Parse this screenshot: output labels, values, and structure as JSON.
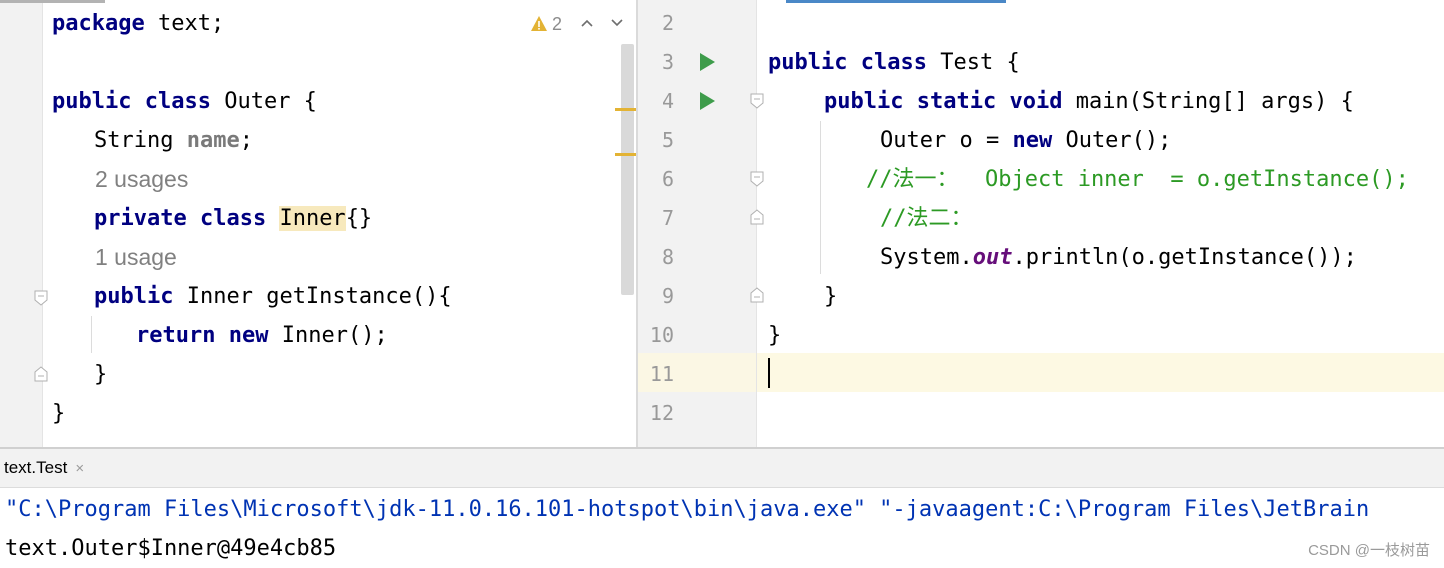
{
  "left_editor": {
    "inspections": {
      "warning_count": "2"
    },
    "lines": {
      "l1": {
        "kw": "package",
        "rest": " text;"
      },
      "l3": {
        "kw1": "public",
        "kw2": "class",
        "rest": " Outer {"
      },
      "l4": {
        "type": "String ",
        "field": "name",
        "end": ";"
      },
      "hint1": "2 usages",
      "l6": {
        "kw1": "private",
        "kw2": "class",
        "name": "Inner",
        "end": "{}"
      },
      "hint2": "1 usage",
      "l8": {
        "kw": "public",
        "rest": " Inner getInstance(){"
      },
      "l9": {
        "kw1": "return",
        "kw2": "new",
        "rest": " Inner();"
      },
      "l10": "}",
      "l11": "}"
    }
  },
  "right_editor": {
    "line_numbers": [
      "2",
      "3",
      "4",
      "5",
      "6",
      "7",
      "8",
      "9",
      "10",
      "11",
      "12"
    ],
    "lines": {
      "l3": {
        "kw1": "public",
        "kw2": "class",
        "rest": " Test {"
      },
      "l4": {
        "kw1": "public",
        "kw2": "static",
        "kw3": "void",
        "rest": " main(String[] args) {"
      },
      "l5": {
        "pre": "Outer o = ",
        "kw": "new",
        "rest": " Outer();"
      },
      "l6": "//法一：  Object inner  = o.getInstance();",
      "l7": "//法二：",
      "l8": {
        "pre": "System.",
        "field": "out",
        "rest": ".println(o.getInstance());"
      },
      "l9": "}",
      "l10": "}"
    }
  },
  "run_window": {
    "tab_label": "text.Test",
    "close_glyph": "×",
    "command_line": "\"C:\\Program Files\\Microsoft\\jdk-11.0.16.101-hotspot\\bin\\java.exe\" \"-javaagent:C:\\Program Files\\JetBrain",
    "output_line": "text.Outer$Inner@49e4cb85"
  },
  "watermark": "CSDN @一枝树苗",
  "colors": {
    "keyword": "#000080",
    "comment": "#2c9a24",
    "static_field": "#660e7a",
    "run_icon": "#3e9c4b",
    "warning": "#e3b334",
    "console_command": "#0033b3"
  },
  "icons": {
    "warning": "warning-triangle-icon",
    "up": "chevron-up-icon",
    "down": "chevron-down-icon",
    "run": "run-gutter-icon"
  }
}
